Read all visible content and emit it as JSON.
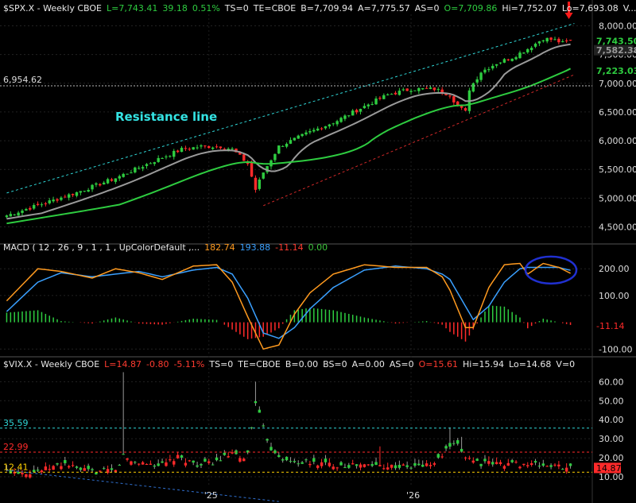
{
  "price_header": {
    "symbol": "$SPX.X - Weekly  CBOE",
    "last": "L=7,743.41",
    "chg": "39.18",
    "pct": "0.51%",
    "ts": "TS=0",
    "te": "TE=CBOE",
    "bid": "B=7,709.94",
    "ask": "A=7,775.57",
    "as": "AS=0",
    "open": "O=7,709.86",
    "high": "Hi=7,752.07",
    "low": "Lo=7,693.08",
    "vol": "V..."
  },
  "macd_header": {
    "label": "MACD ( 12 , 26 , 9 , 1 , 1 , UpColorDefault ,...",
    "macd": "182.74",
    "signal": "193.88",
    "hist": "-11.14",
    "zero": "0.00"
  },
  "vix_header": {
    "symbol": "$VIX.X - Weekly  CBOE",
    "last": "L=14.87",
    "chg": "-0.80",
    "pct": "-5.11%",
    "ts": "TS=0",
    "te": "TE=CBOE",
    "bid": "B=0.00",
    "bs": "BS=0",
    "ask": "A=0.00",
    "as": "AS=0",
    "open": "O=15.61",
    "high": "Hi=15.94",
    "low": "Lo=14.68",
    "vol": "V=0"
  },
  "annotation": "Resistance line",
  "colors": {
    "up": "#2ecc40",
    "down": "#ff2a2a",
    "ma_fast": "#9a9a9a",
    "ma_slow": "#2ecc40",
    "resistance": "#2fd6d6",
    "support": "#d02828",
    "macd": "#ff9a1f",
    "signal": "#3aa0ff",
    "marker": "#ff1a1a",
    "circle": "#2030d0"
  },
  "chart_data": [
    {
      "type": "candlestick",
      "panel": "price",
      "title": "$SPX.X - Weekly",
      "ylim": [
        4300,
        8200
      ],
      "yticks": [
        "8,000.00",
        "7,500.00",
        "7,000.00",
        "6,500.00",
        "6,000.00",
        "5,500.00",
        "5,000.00",
        "4,500.00"
      ],
      "ytick_values": [
        8000,
        7500,
        7000,
        6500,
        6000,
        5500,
        5000,
        4500
      ],
      "xticks": [
        "'25",
        "'26"
      ],
      "xtick_weeks": [
        52,
        104
      ],
      "weeks": 146,
      "close_profile": [
        [
          0,
          4700
        ],
        [
          10,
          4920
        ],
        [
          18,
          5100
        ],
        [
          28,
          5350
        ],
        [
          38,
          5650
        ],
        [
          45,
          5850
        ],
        [
          50,
          5900
        ],
        [
          55,
          5900
        ],
        [
          58,
          5850
        ],
        [
          62,
          5600
        ],
        [
          64,
          5150
        ],
        [
          66,
          5450
        ],
        [
          70,
          5900
        ],
        [
          78,
          6150
        ],
        [
          85,
          6350
        ],
        [
          92,
          6600
        ],
        [
          98,
          6800
        ],
        [
          104,
          6900
        ],
        [
          110,
          6900
        ],
        [
          114,
          6800
        ],
        [
          116,
          6600
        ],
        [
          118,
          6500
        ],
        [
          119,
          6900
        ],
        [
          122,
          7200
        ],
        [
          126,
          7350
        ],
        [
          130,
          7450
        ],
        [
          134,
          7600
        ],
        [
          138,
          7780
        ],
        [
          141,
          7750
        ],
        [
          143,
          7700
        ],
        [
          145,
          7743
        ]
      ],
      "levels": [
        {
          "label": "6,954.62",
          "value": 6954.62,
          "color": "#dddddd"
        },
        {
          "label": "7,743.50",
          "value": 7743.5,
          "color": "#2ecc40"
        },
        {
          "label": "7,582.38",
          "value": 7582.38,
          "color": "#9a9a9a"
        },
        {
          "label": "7,223.03",
          "value": 7223.03,
          "color": "#2ecc40"
        }
      ],
      "trendlines": [
        {
          "name": "resistance",
          "from": [
            0,
            5090
          ],
          "to": [
            146,
            8040
          ]
        },
        {
          "name": "support",
          "from": [
            66,
            4870
          ],
          "to": [
            146,
            7150
          ]
        }
      ]
    },
    {
      "type": "macd",
      "panel": "macd",
      "ylim": [
        -120,
        260
      ],
      "yticks": [
        "200.00",
        "100.00",
        "-100.00"
      ],
      "ytick_values": [
        200,
        100,
        -100
      ],
      "last_label": "-11.14",
      "macd_profile": [
        [
          0,
          80
        ],
        [
          8,
          200
        ],
        [
          14,
          190
        ],
        [
          22,
          165
        ],
        [
          28,
          200
        ],
        [
          34,
          185
        ],
        [
          40,
          160
        ],
        [
          48,
          210
        ],
        [
          54,
          215
        ],
        [
          58,
          150
        ],
        [
          62,
          20
        ],
        [
          66,
          -100
        ],
        [
          70,
          -85
        ],
        [
          74,
          30
        ],
        [
          78,
          110
        ],
        [
          84,
          180
        ],
        [
          92,
          215
        ],
        [
          100,
          205
        ],
        [
          108,
          205
        ],
        [
          112,
          170
        ],
        [
          114,
          120
        ],
        [
          118,
          -20
        ],
        [
          120,
          -20
        ],
        [
          124,
          130
        ],
        [
          128,
          215
        ],
        [
          132,
          220
        ],
        [
          134,
          180
        ],
        [
          138,
          220
        ],
        [
          142,
          205
        ],
        [
          145,
          183
        ]
      ],
      "signal_profile": [
        [
          0,
          40
        ],
        [
          8,
          150
        ],
        [
          14,
          185
        ],
        [
          22,
          170
        ],
        [
          28,
          180
        ],
        [
          34,
          190
        ],
        [
          40,
          170
        ],
        [
          48,
          195
        ],
        [
          54,
          205
        ],
        [
          58,
          180
        ],
        [
          62,
          90
        ],
        [
          66,
          -40
        ],
        [
          70,
          -60
        ],
        [
          74,
          -20
        ],
        [
          78,
          50
        ],
        [
          84,
          130
        ],
        [
          92,
          195
        ],
        [
          100,
          210
        ],
        [
          108,
          200
        ],
        [
          112,
          180
        ],
        [
          114,
          160
        ],
        [
          118,
          60
        ],
        [
          120,
          10
        ],
        [
          124,
          60
        ],
        [
          128,
          150
        ],
        [
          132,
          200
        ],
        [
          134,
          205
        ],
        [
          138,
          205
        ],
        [
          142,
          205
        ],
        [
          145,
          194
        ]
      ]
    },
    {
      "type": "candlestick",
      "panel": "vix",
      "title": "$VIX.X - Weekly",
      "ylim": [
        5,
        66
      ],
      "yticks": [
        "60.00",
        "50.00",
        "40.00",
        "30.00",
        "20.00",
        "10.00"
      ],
      "ytick_values": [
        60,
        50,
        40,
        30,
        20,
        10
      ],
      "close_profile": [
        [
          0,
          13
        ],
        [
          6,
          12.5
        ],
        [
          10,
          14
        ],
        [
          15,
          17
        ],
        [
          18,
          14
        ],
        [
          22,
          12.5
        ],
        [
          28,
          13
        ],
        [
          30,
          21
        ],
        [
          32,
          18
        ],
        [
          40,
          16
        ],
        [
          44,
          20
        ],
        [
          50,
          16
        ],
        [
          54,
          18
        ],
        [
          58,
          22
        ],
        [
          60,
          19
        ],
        [
          62,
          22
        ],
        [
          64,
          50
        ],
        [
          66,
          35
        ],
        [
          68,
          25
        ],
        [
          72,
          18
        ],
        [
          80,
          17
        ],
        [
          88,
          16
        ],
        [
          96,
          16
        ],
        [
          104,
          15
        ],
        [
          110,
          17
        ],
        [
          114,
          26
        ],
        [
          116,
          26
        ],
        [
          118,
          21
        ],
        [
          122,
          17
        ],
        [
          130,
          17
        ],
        [
          138,
          16
        ],
        [
          145,
          14.87
        ]
      ],
      "spikes": [
        [
          30,
          65
        ],
        [
          64,
          60
        ],
        [
          114,
          36
        ],
        [
          117,
          31
        ],
        [
          96,
          26
        ]
      ],
      "levels": [
        {
          "label": "35.59",
          "value": 35.59,
          "color": "#2fd6d6"
        },
        {
          "label": "22.99",
          "value": 22.99,
          "color": "#ff2a2a"
        },
        {
          "label": "12.41",
          "value": 12.41,
          "color": "#ffd000"
        },
        {
          "label": "14.87",
          "value": 14.87,
          "color": "#ff2a2a"
        }
      ],
      "trendlines": [
        {
          "name": "downtrend",
          "from": [
            0,
            13.5
          ],
          "to": [
            70,
            -3
          ]
        }
      ]
    }
  ]
}
